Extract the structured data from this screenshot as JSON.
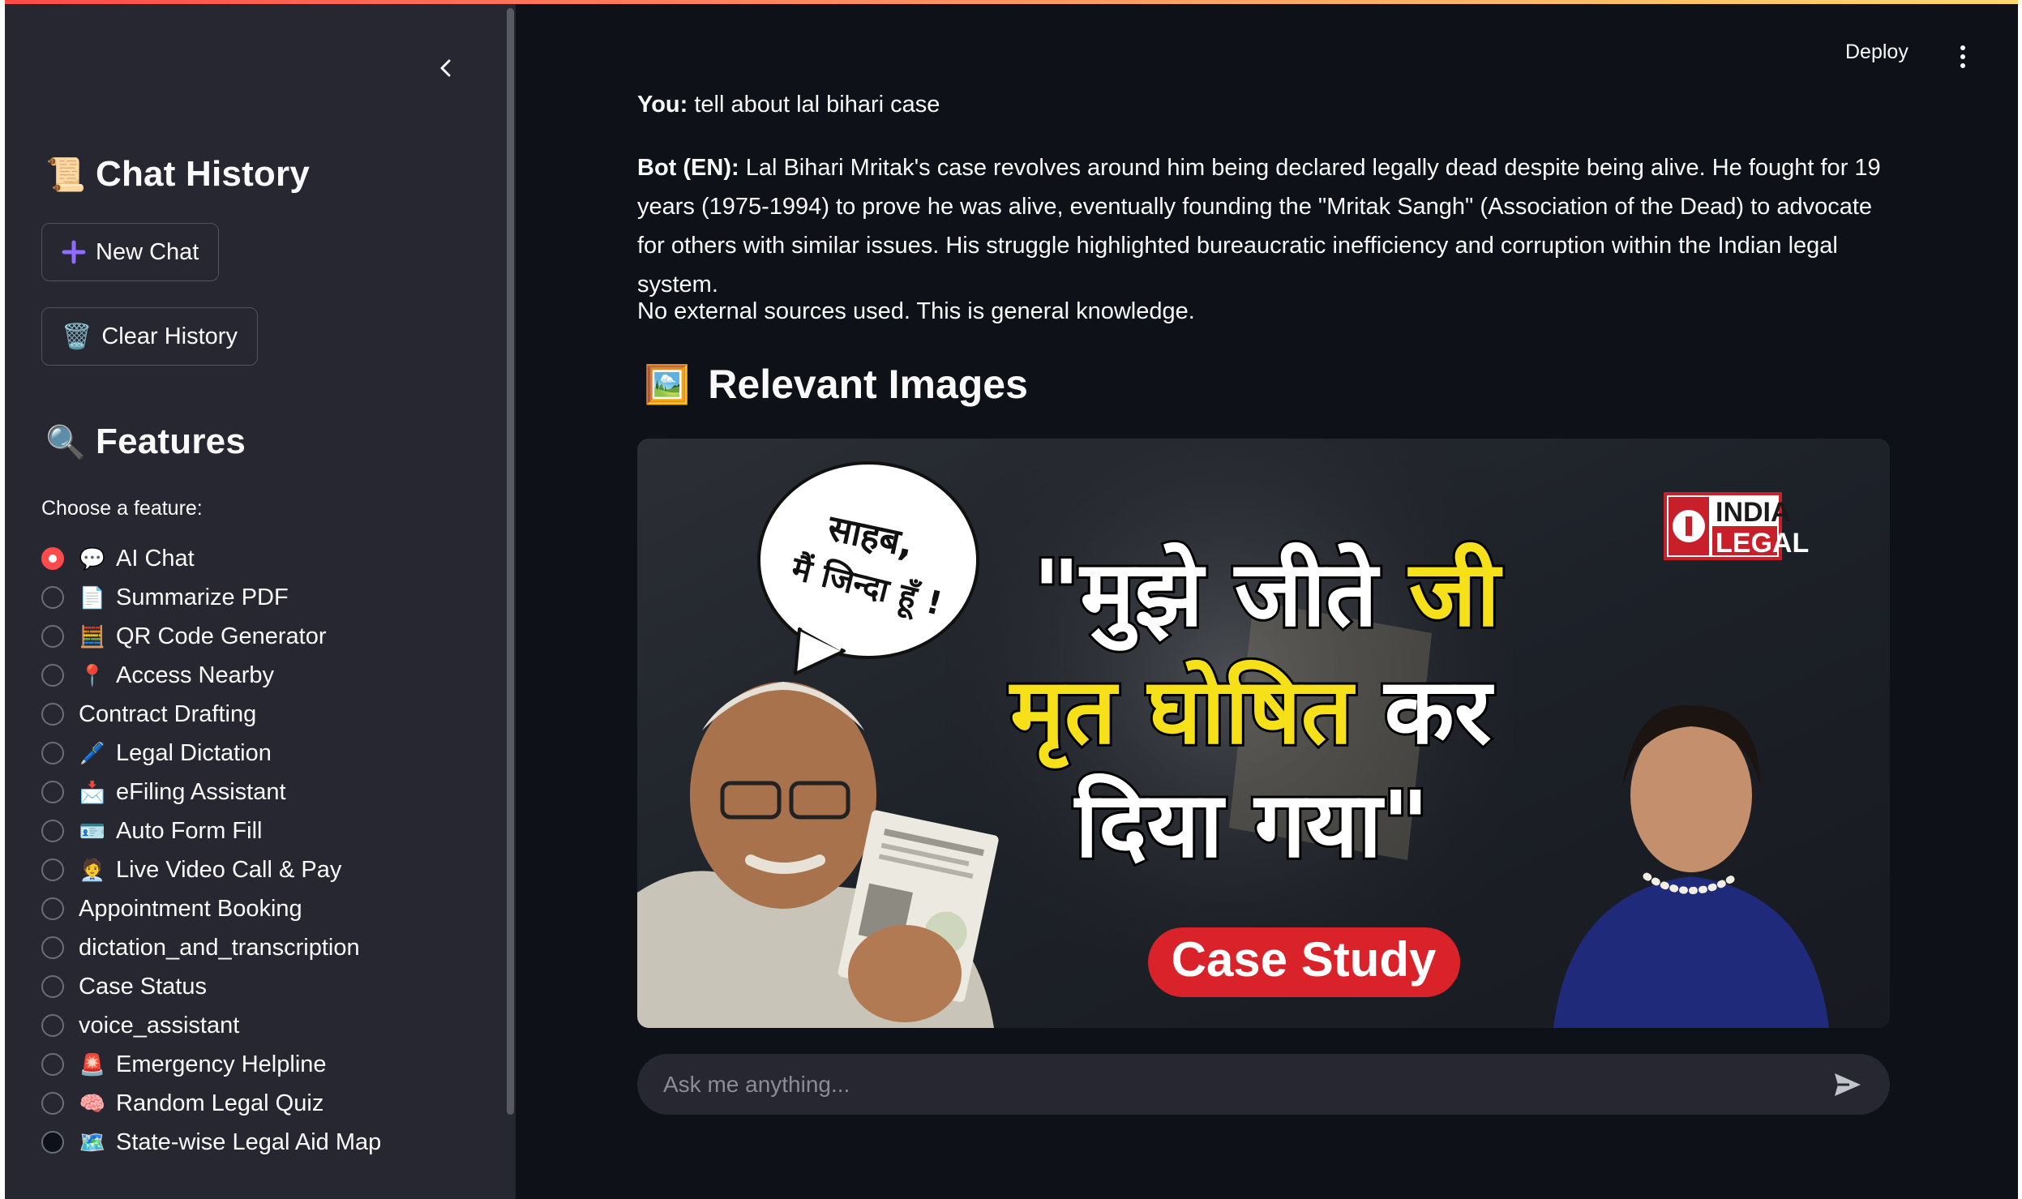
{
  "app": {
    "deploy_label": "Deploy"
  },
  "sidebar": {
    "chat_history": {
      "icon": "📜",
      "title": "Chat History",
      "new_chat_label": "New Chat",
      "clear_history_icon": "🗑️",
      "clear_history_label": "Clear History"
    },
    "features": {
      "icon": "🔍",
      "title": "Features",
      "choose_label": "Choose a feature:",
      "selected": "AI Chat",
      "options": [
        {
          "icon": "💬",
          "label": "AI Chat"
        },
        {
          "icon": "📄",
          "label": "Summarize PDF"
        },
        {
          "icon": "🧮",
          "label": "QR Code Generator"
        },
        {
          "icon": "📍",
          "label": "Access Nearby"
        },
        {
          "icon": "",
          "label": "Contract Drafting"
        },
        {
          "icon": "🖊️",
          "label": "Legal Dictation"
        },
        {
          "icon": "📩",
          "label": "eFiling Assistant"
        },
        {
          "icon": "🪪",
          "label": "Auto Form Fill"
        },
        {
          "icon": "🧑‍💼",
          "label": "Live Video Call & Pay"
        },
        {
          "icon": "",
          "label": "Appointment Booking"
        },
        {
          "icon": "",
          "label": "dictation_and_transcription"
        },
        {
          "icon": "",
          "label": "Case Status"
        },
        {
          "icon": "",
          "label": "voice_assistant"
        },
        {
          "icon": "🚨",
          "label": "Emergency Helpline"
        },
        {
          "icon": "🧠",
          "label": "Random Legal Quiz"
        },
        {
          "icon": "🗺️",
          "label": "State-wise Legal Aid Map"
        }
      ]
    }
  },
  "chat": {
    "user_prefix": "You:",
    "user_text": "tell about lal bihari case",
    "bot_prefix": "Bot (EN):",
    "bot_text": "Lal Bihari Mritak's case revolves around him being declared legally dead despite being alive. He fought for 19 years (1975-1994) to prove he was alive, eventually founding the \"Mritak Sangh\" (Association of the Dead) to advocate for others with similar issues. His struggle highlighted bureaucratic inefficiency and corruption within the Indian legal system.",
    "sources_note": "No external sources used. This is general knowledge.",
    "images_icon": "🖼️",
    "images_heading": "Relevant Images",
    "image": {
      "speech_line1": "साहब,",
      "speech_line2": "मैं जिन्दा हूँ !",
      "headline_line1_white": "\"मुझे जीते ",
      "headline_line1_yellow": "जी",
      "headline_line2_yellow": "मृत घोषित ",
      "headline_line2_white": "कर",
      "headline_line3": "दिया गया\"",
      "badge": "Case Study",
      "logo_top": "INDIA",
      "logo_bottom": "LEGAL"
    },
    "input_placeholder": "Ask me anything..."
  },
  "colors": {
    "accent": "#ff4b4b",
    "app_bg": "#0e1117",
    "sidebar_bg": "#262730",
    "text": "#fafafa",
    "image_yellow": "#f5e01a",
    "badge_red": "#d9222a"
  }
}
